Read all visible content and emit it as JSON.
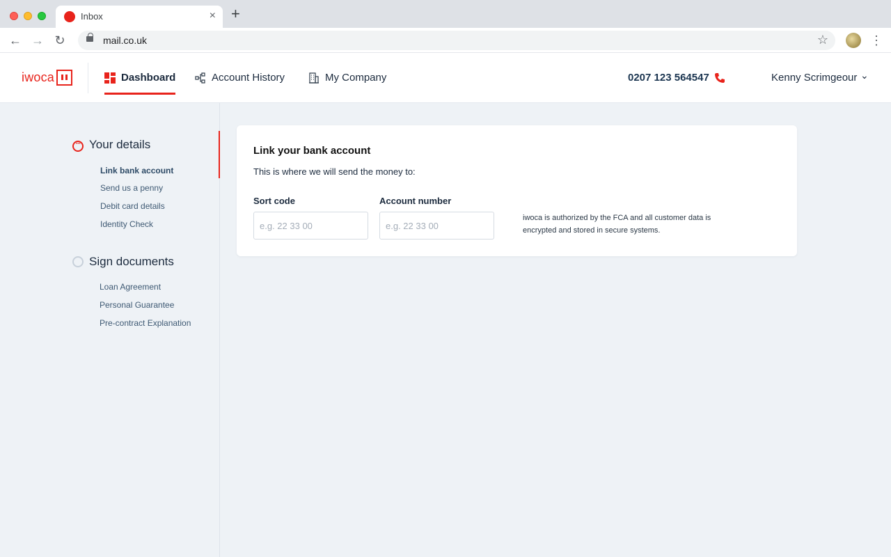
{
  "browser": {
    "tab_title": "Inbox",
    "tab_close": "×",
    "new_tab": "+",
    "url": "mail.co.uk",
    "back": "←",
    "forward": "→",
    "reload": "↻",
    "bookmark": "☆",
    "menu": "⋮"
  },
  "header": {
    "logo": "iwoca",
    "nav": [
      {
        "label": "Dashboard",
        "icon": "dashboard-icon",
        "active": true
      },
      {
        "label": "Account History",
        "icon": "account-history-icon"
      },
      {
        "label": "My Company",
        "icon": "company-building-icon"
      }
    ],
    "phone": "0207 123 564547",
    "user_name": "Kenny Scrimgeour",
    "user_chevron": "⌄",
    "accent_color": "#e8231b"
  },
  "sidebar": {
    "sections": [
      {
        "title": "Your details",
        "status": "in-progress",
        "items": [
          "Link bank account",
          "Send us a penny",
          "Debit card details",
          "Identity Check"
        ],
        "active_item": "Link bank account"
      },
      {
        "title": "Sign documents",
        "status": "not-started",
        "items": [
          "Loan Agreement",
          "Personal Guarantee",
          "Pre-contract Explanation"
        ]
      }
    ]
  },
  "card": {
    "title": "Link your bank account",
    "subtitle": "This is where we will send the money to:",
    "sort_code": {
      "label": "Sort code",
      "placeholder": "e.g. 22 33 00",
      "value": ""
    },
    "account_number": {
      "label": "Account number",
      "placeholder": "e.g. 22 33 00",
      "value": ""
    },
    "note": "iwoca is authorized by the FCA and all customer data is encrypted and stored in secure systems."
  }
}
